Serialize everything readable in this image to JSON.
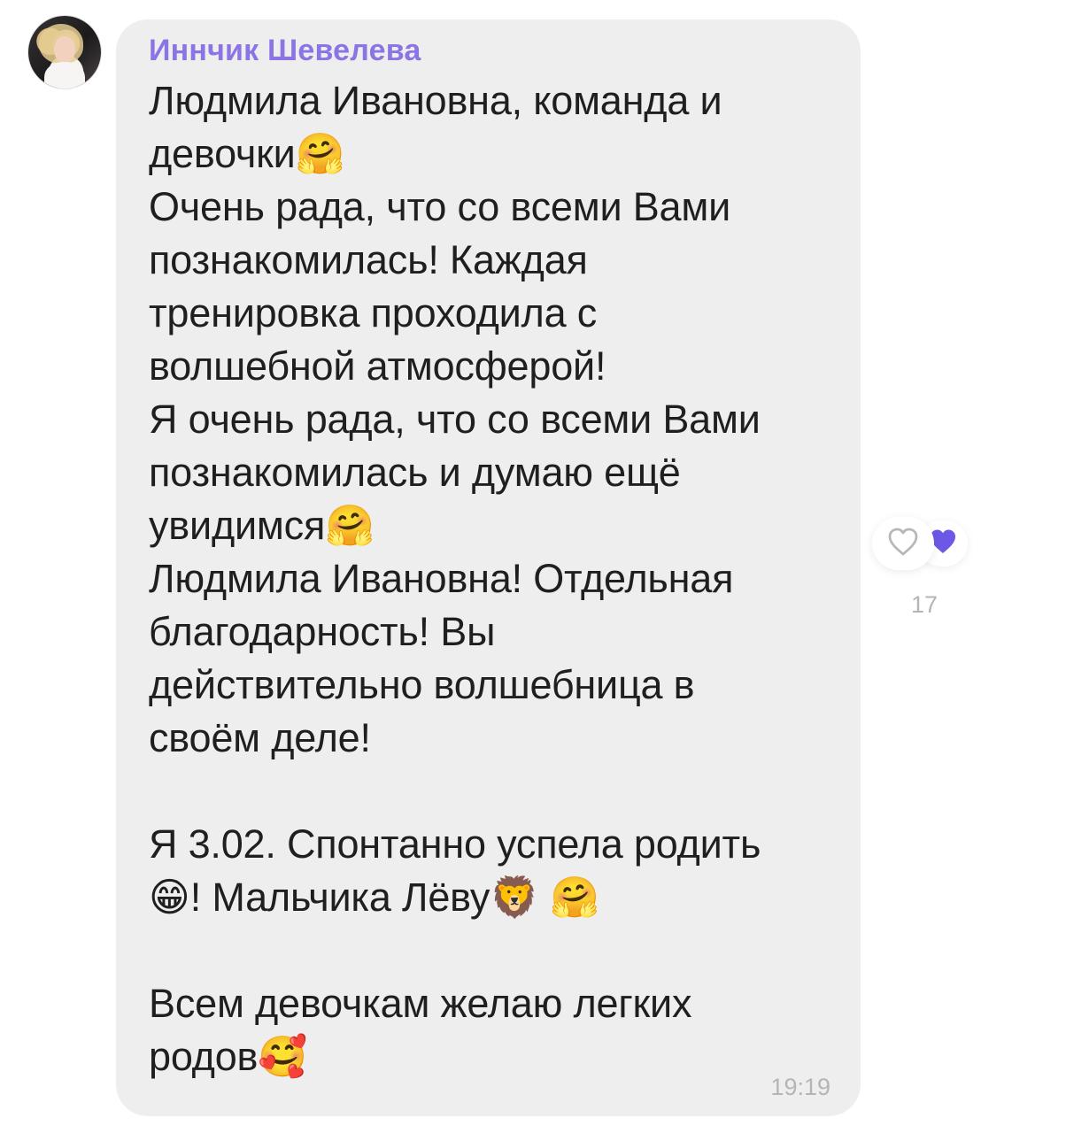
{
  "sender": {
    "name": "Иннчик Шевелева"
  },
  "message": {
    "text": "Людмила Ивановна, команда и\nдевочки🤗\nОчень рада, что со всеми Вами\nпознакомилась! Каждая\nтренировка проходила с\nволшебной атмосферой!\nЯ очень рада, что со всеми Вами\nпознакомилась и думаю ещё\nувидимся🤗\nЛюдмила Ивановна! Отдельная\nблагодарность! Вы\nдействительно волшебница в\nсвоём деле!\n\nЯ 3.02. Спонтанно успела родить\n😁! Мальчика Лёву🦁 🤗\n\nВсем девочкам желаю легких\nродов🥰",
    "time": "19:19"
  },
  "reactions": {
    "count": "17",
    "icons": {
      "like": "heart-outline-icon",
      "reacted": "heart-filled-icon"
    },
    "colors": {
      "sender": "#8d74e5",
      "reacted_heart": "#6c58e6",
      "outline_heart": "#b8b8bc"
    }
  }
}
